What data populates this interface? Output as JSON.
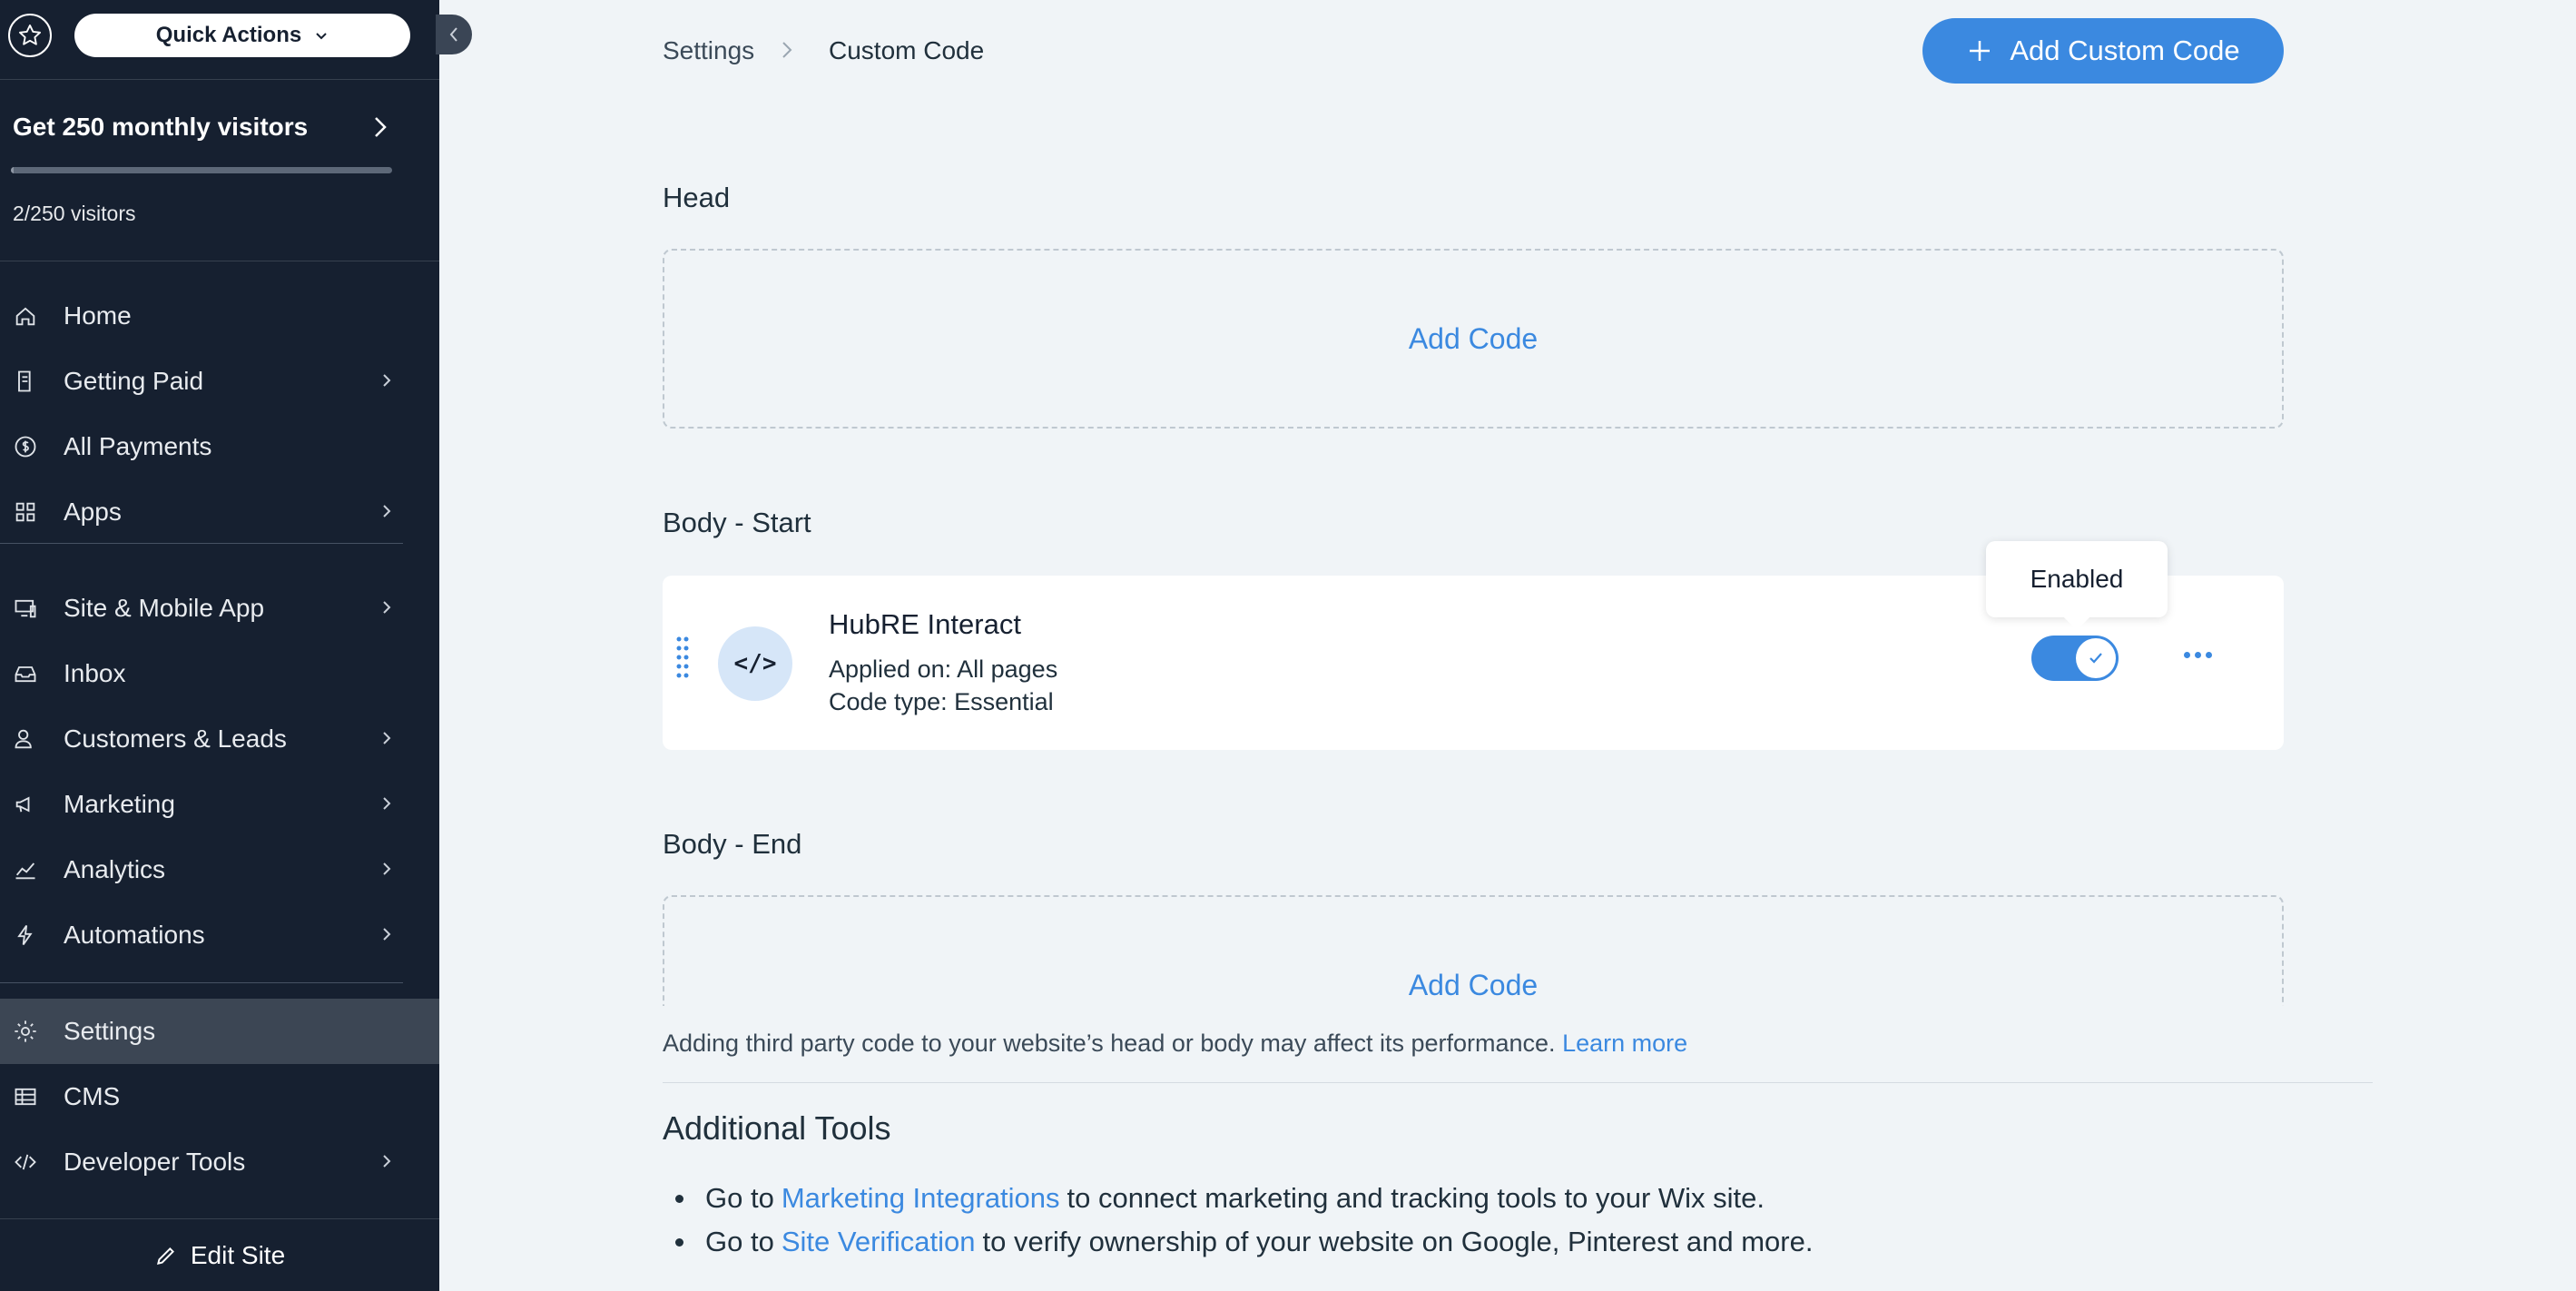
{
  "sidebar": {
    "quick_actions": "Quick Actions",
    "promo": {
      "title": "Get 250 monthly visitors",
      "subtitle": "2/250 visitors",
      "progress_fraction": 0.008
    },
    "items": [
      {
        "label": "Home",
        "icon": "home-icon",
        "has_chevron": false
      },
      {
        "label": "Getting Paid",
        "icon": "receipt-icon",
        "has_chevron": true
      },
      {
        "label": "All Payments",
        "icon": "dollar-icon",
        "has_chevron": false
      },
      {
        "label": "Apps",
        "icon": "apps-icon",
        "has_chevron": true
      },
      {
        "label": "Site & Mobile App",
        "icon": "devices-icon",
        "has_chevron": true
      },
      {
        "label": "Inbox",
        "icon": "inbox-icon",
        "has_chevron": false
      },
      {
        "label": "Customers & Leads",
        "icon": "people-icon",
        "has_chevron": true
      },
      {
        "label": "Marketing",
        "icon": "megaphone-icon",
        "has_chevron": true
      },
      {
        "label": "Analytics",
        "icon": "chart-icon",
        "has_chevron": true
      },
      {
        "label": "Automations",
        "icon": "bolt-icon",
        "has_chevron": true
      },
      {
        "label": "Settings",
        "icon": "gear-icon",
        "has_chevron": false,
        "active": true
      },
      {
        "label": "CMS",
        "icon": "table-icon",
        "has_chevron": false
      },
      {
        "label": "Developer Tools",
        "icon": "code-icon",
        "has_chevron": true
      }
    ],
    "edit_site": "Edit Site"
  },
  "breadcrumb": {
    "parent": "Settings",
    "current": "Custom Code"
  },
  "add_custom_code": "Add Custom Code",
  "sections": {
    "head": {
      "title": "Head",
      "add_label": "Add Code"
    },
    "body_start": {
      "title": "Body - Start"
    },
    "body_end": {
      "title": "Body - End",
      "add_label": "Add Code"
    }
  },
  "code_item": {
    "name": "HubRE Interact",
    "applied_on": "Applied on: All pages",
    "code_type": "Code type: Essential",
    "avatar_text": "</>",
    "enabled": true,
    "tooltip": "Enabled"
  },
  "warning": {
    "text": "Adding third party code to your website’s head or body may affect its performance.",
    "link": "Learn more"
  },
  "additional_tools": {
    "title": "Additional Tools",
    "items": [
      {
        "prefix": "Go to",
        "link": "Marketing Integrations",
        "suffix": "to connect marketing and tracking tools to your Wix site."
      },
      {
        "prefix": "Go to",
        "link": "Site Verification",
        "suffix": "to verify ownership of your website on Google, Pinterest and more."
      }
    ]
  },
  "colors": {
    "sidebar_bg": "#162030",
    "accent": "#3b89e0",
    "page_bg": "#f0f4f7"
  }
}
